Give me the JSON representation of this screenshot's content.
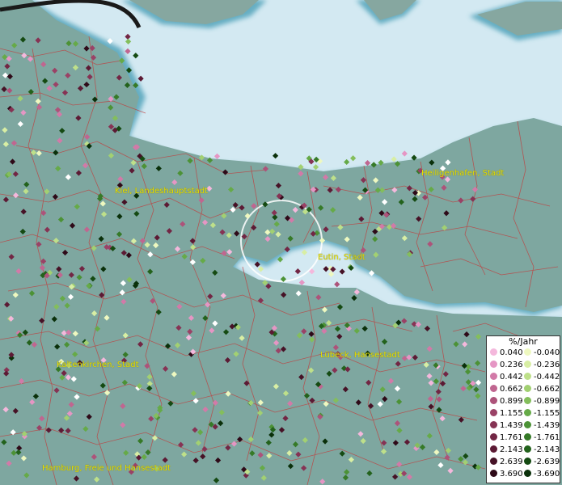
{
  "map": {
    "cities": [
      {
        "name": "Kiel, Landeshauptstadt"
      },
      {
        "name": "Heiligenhafen, Stadt"
      },
      {
        "name": "Eutin, Stadt"
      },
      {
        "name": "Lübeck, Hansestadt"
      },
      {
        "name": "Kaltenkirchen, Stadt"
      },
      {
        "name": "Hamburg, Freie und Hansestadt"
      }
    ]
  },
  "legend": {
    "title": "%/Jahr",
    "positive": [
      {
        "value": "0.040",
        "color": "#f4b8dc"
      },
      {
        "value": "0.236",
        "color": "#e596c4"
      },
      {
        "value": "0.442",
        "color": "#d27aa8"
      },
      {
        "value": "0.662",
        "color": "#c06690"
      },
      {
        "value": "0.899",
        "color": "#ad537a"
      },
      {
        "value": "1.155",
        "color": "#9a4266"
      },
      {
        "value": "1.439",
        "color": "#863354"
      },
      {
        "value": "1.761",
        "color": "#722644"
      },
      {
        "value": "2.143",
        "color": "#5c1a34"
      },
      {
        "value": "2.639",
        "color": "#461226"
      },
      {
        "value": "3.690",
        "color": "#2e0a18"
      }
    ],
    "negative": [
      {
        "value": "-0.040",
        "color": "#eef8c0"
      },
      {
        "value": "-0.236",
        "color": "#d8eea4"
      },
      {
        "value": "-0.442",
        "color": "#bee08a"
      },
      {
        "value": "-0.662",
        "color": "#a2d072"
      },
      {
        "value": "-0.899",
        "color": "#84be5c"
      },
      {
        "value": "-1.155",
        "color": "#66aa48"
      },
      {
        "value": "-1.439",
        "color": "#4c9236"
      },
      {
        "value": "-1.761",
        "color": "#367a28"
      },
      {
        "value": "-2.143",
        "color": "#23621c"
      },
      {
        "value": "-2.639",
        "color": "#154a12"
      },
      {
        "value": "-3.690",
        "color": "#0a300a"
      }
    ]
  }
}
